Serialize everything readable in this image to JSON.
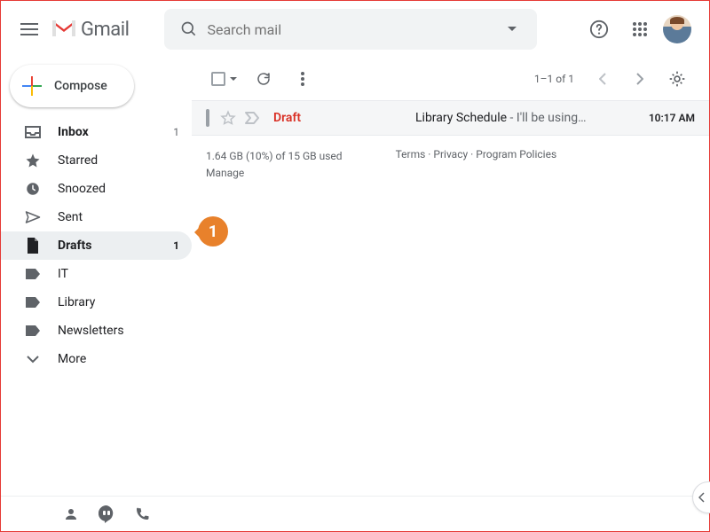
{
  "app": {
    "name": "Gmail"
  },
  "search": {
    "placeholder": "Search mail"
  },
  "compose": {
    "label": "Compose"
  },
  "sidebar": {
    "items": [
      {
        "key": "inbox",
        "label": "Inbox",
        "count": "1"
      },
      {
        "key": "starred",
        "label": "Starred"
      },
      {
        "key": "snoozed",
        "label": "Snoozed"
      },
      {
        "key": "sent",
        "label": "Sent"
      },
      {
        "key": "drafts",
        "label": "Drafts",
        "count": "1",
        "active": true
      },
      {
        "key": "it",
        "label": "IT"
      },
      {
        "key": "library",
        "label": "Library"
      },
      {
        "key": "newsletters",
        "label": "Newsletters"
      },
      {
        "key": "more",
        "label": "More"
      }
    ]
  },
  "toolbar": {
    "pager": "1–1 of 1"
  },
  "messages": [
    {
      "sender": "Draft",
      "subject": "Library Schedule",
      "snippet": " - I'll be using…",
      "time": "10:17 AM"
    }
  ],
  "footer": {
    "storage_line1": "1.64 GB (10%) of 15 GB used",
    "storage_line2": "Manage",
    "terms": "Terms",
    "privacy": "Privacy",
    "policies": "Program Policies",
    "sep": " · "
  },
  "annotation": {
    "number": "1"
  }
}
